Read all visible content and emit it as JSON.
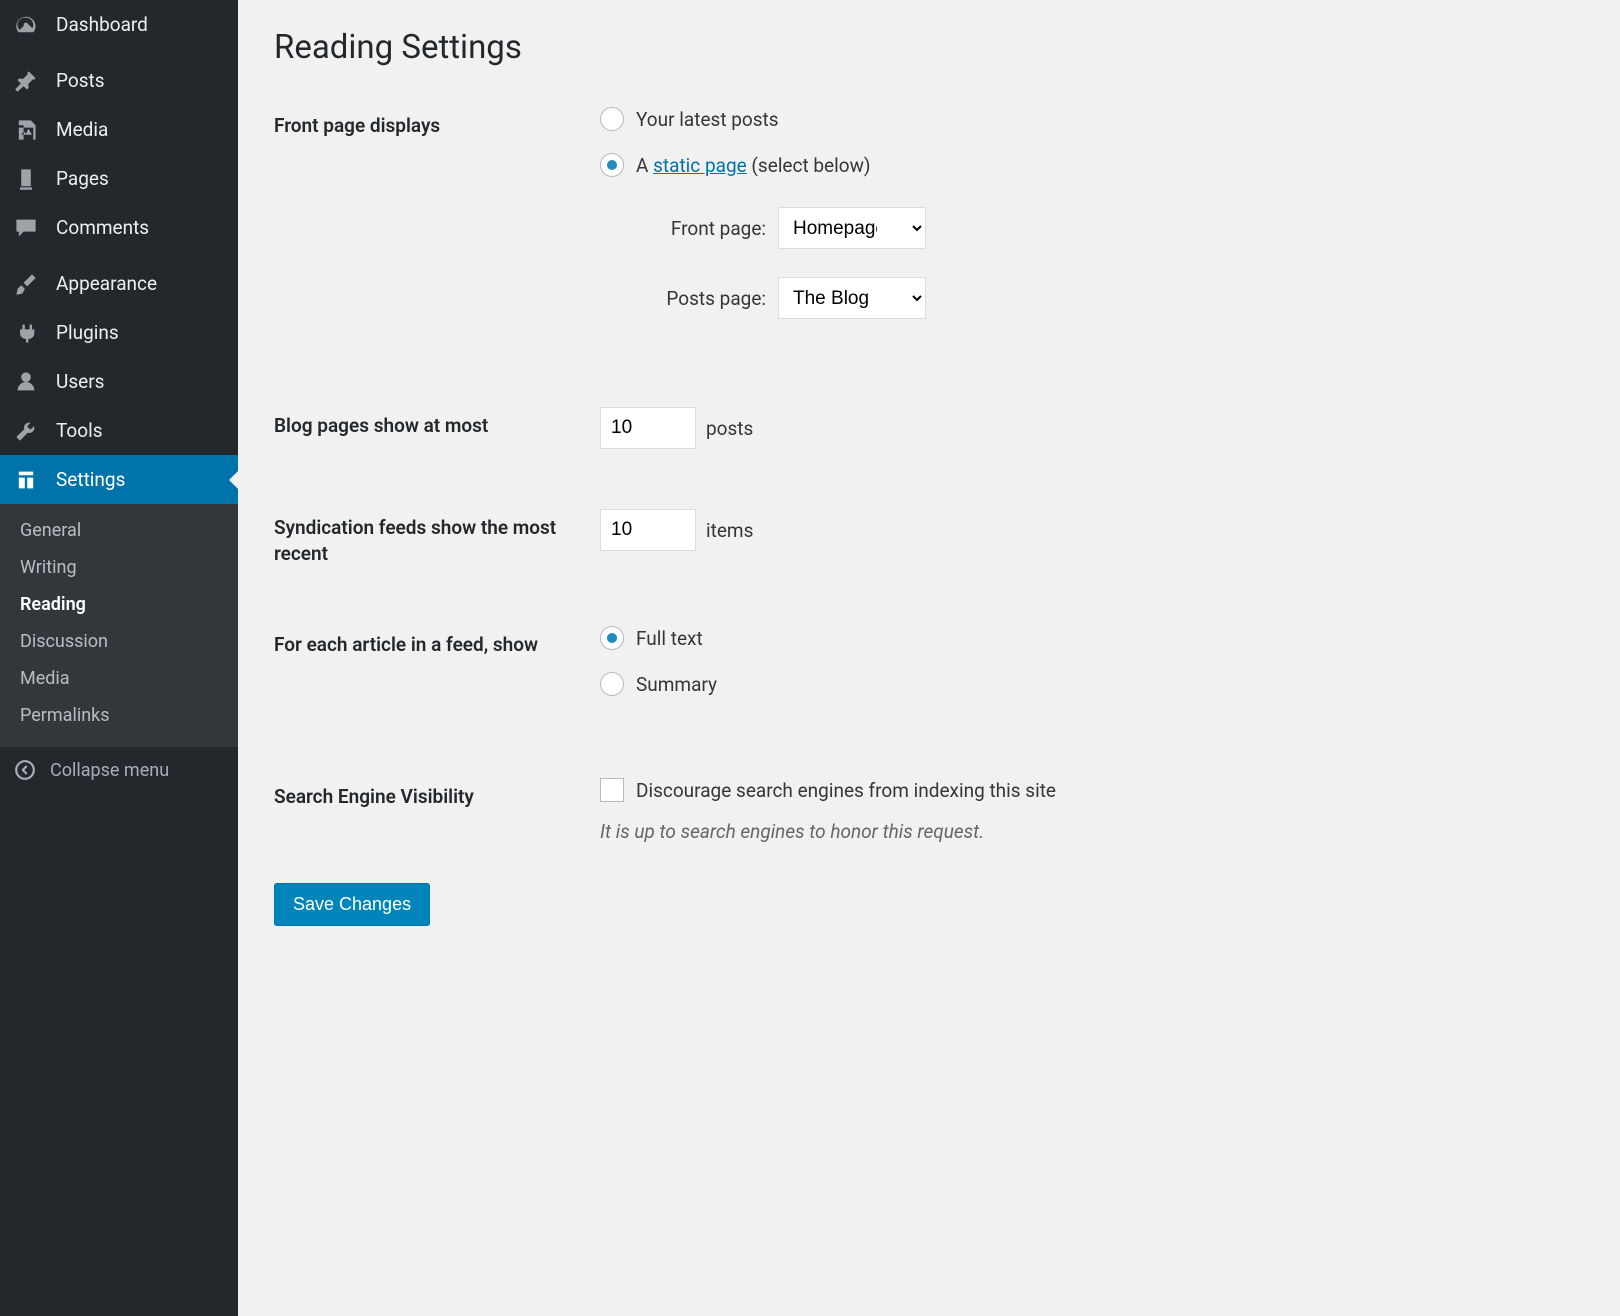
{
  "sidebar": {
    "items": [
      {
        "label": "Dashboard"
      },
      {
        "label": "Posts"
      },
      {
        "label": "Media"
      },
      {
        "label": "Pages"
      },
      {
        "label": "Comments"
      },
      {
        "label": "Appearance"
      },
      {
        "label": "Plugins"
      },
      {
        "label": "Users"
      },
      {
        "label": "Tools"
      },
      {
        "label": "Settings"
      }
    ],
    "submenu": [
      {
        "label": "General"
      },
      {
        "label": "Writing"
      },
      {
        "label": "Reading"
      },
      {
        "label": "Discussion"
      },
      {
        "label": "Media"
      },
      {
        "label": "Permalinks"
      }
    ],
    "collapse_label": "Collapse menu"
  },
  "page": {
    "title": "Reading Settings",
    "save_label": "Save Changes"
  },
  "front_page": {
    "label": "Front page displays",
    "option_latest": "Your latest posts",
    "option_static_prefix": "A ",
    "option_static_link": "static page",
    "option_static_suffix": " (select below)",
    "front_label": "Front page:",
    "front_value": "Homepage",
    "posts_label": "Posts page:",
    "posts_value": "The Blog"
  },
  "blog_pages": {
    "label": "Blog pages show at most",
    "value": "10",
    "suffix": "posts"
  },
  "syndication": {
    "label": "Syndication feeds show the most recent",
    "value": "10",
    "suffix": "items"
  },
  "feed_content": {
    "label": "For each article in a feed, show",
    "option_full": "Full text",
    "option_summary": "Summary"
  },
  "search_visibility": {
    "label": "Search Engine Visibility",
    "checkbox_label": "Discourage search engines from indexing this site",
    "desc": "It is up to search engines to honor this request."
  }
}
